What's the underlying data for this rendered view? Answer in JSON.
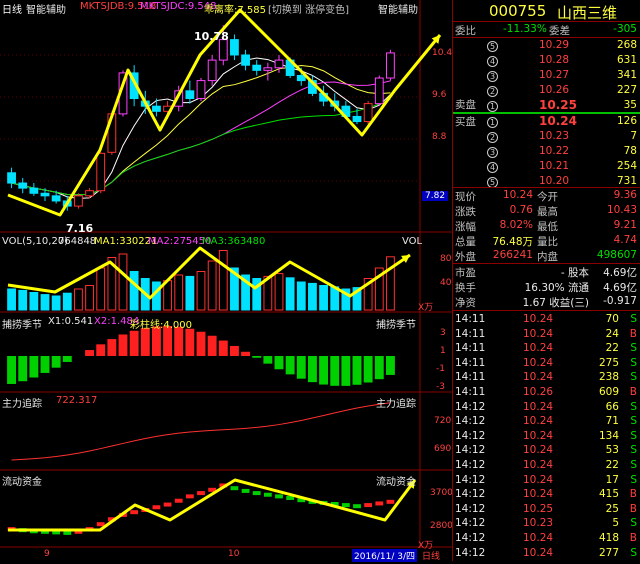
{
  "chart": {
    "panels": [
      {
        "title": "日线",
        "indicator": "智能辅助",
        "readouts": [
          {
            "text": "MKTSJDB:9.518",
            "color": "#ff4040"
          },
          {
            "text": "MKTSJDC:9.548",
            "color": "#ff40ff"
          },
          {
            "text": "乖离率:7.585",
            "color": "#ffff40"
          },
          {
            "text": "[切换到 涨停变色]",
            "color": "#c0c0c0"
          }
        ],
        "right_title": "智能辅助",
        "ticks": [
          "10.4",
          "9.6",
          "8.8"
        ],
        "last_value": "7.82",
        "high_label": "10.78",
        "low_label": "7.16"
      },
      {
        "title": "VOL(5,10,20)",
        "readouts": [
          {
            "text": "764848",
            "color": "#e8e8e8"
          },
          {
            "text": "MA1:330221",
            "color": "#ffff40"
          },
          {
            "text": "MA2:275450",
            "color": "#ff40ff"
          },
          {
            "text": "MA3:363480",
            "color": "#00e000"
          }
        ],
        "right_title": "VOL",
        "ticks": [
          "80",
          "40"
        ],
        "unit": "X万"
      },
      {
        "title": "捕捞季节",
        "readouts": [
          {
            "text": "X1:0.541",
            "color": "#e8e8e8"
          },
          {
            "text": "X2:1.484",
            "color": "#ff40ff"
          },
          {
            "text": "彩柱线:4.000",
            "color": "#ffff40"
          }
        ],
        "right_title": "捕捞季节",
        "ticks": [
          "3",
          "1",
          "-1",
          "-3"
        ]
      },
      {
        "title": "主力追踪",
        "readouts": [
          {
            "text": "722.317",
            "color": "#ff4040"
          }
        ],
        "right_title": "主力追踪",
        "ticks": [
          "720",
          "690"
        ]
      },
      {
        "title": "流动资金",
        "readouts": [],
        "right_title": "流动资金",
        "ticks": [
          "3700",
          "2800"
        ],
        "unit": "X万"
      }
    ],
    "x_labels": [
      "9",
      "10"
    ],
    "date_label": "2016/11/ 3/四",
    "period_tab": "日线"
  },
  "chart_data": {
    "type": "candlestick",
    "series": [
      {
        "name": "K线",
        "ohlc": [
          [
            7.9,
            8.0,
            7.6,
            7.7
          ],
          [
            7.7,
            7.8,
            7.5,
            7.6
          ],
          [
            7.6,
            7.7,
            7.45,
            7.5
          ],
          [
            7.5,
            7.6,
            7.35,
            7.45
          ],
          [
            7.45,
            7.55,
            7.3,
            7.35
          ],
          [
            7.35,
            7.45,
            7.16,
            7.25
          ],
          [
            7.25,
            7.5,
            7.2,
            7.45
          ],
          [
            7.45,
            7.6,
            7.4,
            7.55
          ],
          [
            7.55,
            8.3,
            7.5,
            8.28
          ],
          [
            8.3,
            9.1,
            8.25,
            9.05
          ],
          [
            9.05,
            9.9,
            9.0,
            9.85
          ],
          [
            9.85,
            10.0,
            9.2,
            9.35
          ],
          [
            9.3,
            9.5,
            9.05,
            9.2
          ],
          [
            9.2,
            9.35,
            9.0,
            9.1
          ],
          [
            9.1,
            9.3,
            8.95,
            9.2
          ],
          [
            9.2,
            9.6,
            9.1,
            9.5
          ],
          [
            9.5,
            9.7,
            9.25,
            9.35
          ],
          [
            9.35,
            9.75,
            9.3,
            9.7
          ],
          [
            9.7,
            10.2,
            9.6,
            10.1
          ],
          [
            10.1,
            10.78,
            10.0,
            10.5
          ],
          [
            10.5,
            10.6,
            10.1,
            10.2
          ],
          [
            10.2,
            10.3,
            9.9,
            10.0
          ],
          [
            10.0,
            10.1,
            9.8,
            9.9
          ],
          [
            9.9,
            10.05,
            9.7,
            9.95
          ],
          [
            9.95,
            10.2,
            9.85,
            10.1
          ],
          [
            10.1,
            10.15,
            9.75,
            9.8
          ],
          [
            9.8,
            9.95,
            9.6,
            9.7
          ],
          [
            9.7,
            9.8,
            9.4,
            9.45
          ],
          [
            9.45,
            9.6,
            9.2,
            9.3
          ],
          [
            9.3,
            9.45,
            9.1,
            9.2
          ],
          [
            9.2,
            9.3,
            8.95,
            9.0
          ],
          [
            9.0,
            9.15,
            8.85,
            8.9
          ],
          [
            8.9,
            9.3,
            8.85,
            9.25
          ],
          [
            9.25,
            9.8,
            9.2,
            9.75
          ],
          [
            9.75,
            10.3,
            9.7,
            10.24
          ]
        ]
      }
    ],
    "volume": [
      30,
      28,
      25,
      22,
      20,
      24,
      30,
      35,
      60,
      75,
      80,
      55,
      45,
      40,
      42,
      50,
      48,
      55,
      70,
      85,
      60,
      50,
      45,
      48,
      52,
      46,
      40,
      38,
      35,
      33,
      30,
      32,
      45,
      60,
      76
    ],
    "flow": [
      2900,
      2880,
      2860,
      2850,
      2840,
      2830,
      2850,
      2900,
      2990,
      3080,
      3160,
      3210,
      3250,
      3300,
      3350,
      3420,
      3500,
      3560,
      3620,
      3700,
      3650,
      3600,
      3560,
      3530,
      3500,
      3470,
      3430,
      3400,
      3380,
      3360,
      3340,
      3320,
      3340,
      3370,
      3400
    ],
    "price_range": [
      6.9,
      11.0
    ]
  },
  "quote": {
    "code": "000755",
    "name": "山西三维",
    "weibi_label": "委比",
    "weibi_value": "-11.33%",
    "weicha_label": "委差",
    "weicha_value": "-305",
    "sell_label": "卖盘",
    "buy_label": "买盘",
    "asks": [
      {
        "level": "5",
        "price": "10.29",
        "vol": "268"
      },
      {
        "level": "4",
        "price": "10.28",
        "vol": "631"
      },
      {
        "level": "3",
        "price": "10.27",
        "vol": "341"
      },
      {
        "level": "2",
        "price": "10.26",
        "vol": "227"
      },
      {
        "level": "1",
        "price": "10.25",
        "vol": "35"
      }
    ],
    "bids": [
      {
        "level": "1",
        "price": "10.24",
        "vol": "126"
      },
      {
        "level": "2",
        "price": "10.23",
        "vol": "7"
      },
      {
        "level": "3",
        "price": "10.22",
        "vol": "78"
      },
      {
        "level": "4",
        "price": "10.21",
        "vol": "254"
      },
      {
        "level": "5",
        "price": "10.20",
        "vol": "731"
      }
    ],
    "stats": [
      {
        "l1": "现价",
        "v1": "10.24",
        "c1": "#ff4040",
        "l2": "今开",
        "v2": "9.36",
        "c2": "#ff4040"
      },
      {
        "l1": "涨跌",
        "v1": "0.76",
        "c1": "#ff4040",
        "l2": "最高",
        "v2": "10.43",
        "c2": "#ff4040"
      },
      {
        "l1": "涨幅",
        "v1": "8.02%",
        "c1": "#ff4040",
        "l2": "最低",
        "v2": "9.21",
        "c2": "#ff4040"
      },
      {
        "l1": "总量",
        "v1": "76.48万",
        "c1": "#ffff40",
        "l2": "量比",
        "v2": "4.74",
        "c2": "#ff4040"
      },
      {
        "l1": "外盘",
        "v1": "266241",
        "c1": "#ff4040",
        "l2": "内盘",
        "v2": "498607",
        "c2": "#00e000"
      }
    ],
    "stats2": [
      {
        "l1": "市盈",
        "v1": "- 股本",
        "l2": "",
        "v2": "4.69亿"
      },
      {
        "l1": "换手",
        "v1": "16.30% 流通",
        "l2": "",
        "v2": "4.69亿"
      },
      {
        "l1": "净资",
        "v1": "1.67 收益(三)",
        "l2": "",
        "v2": "-0.917"
      }
    ],
    "ticks": [
      {
        "t": "14:11",
        "p": "10.24",
        "v": "70",
        "s": "S"
      },
      {
        "t": "14:11",
        "p": "10.24",
        "v": "24",
        "s": "B"
      },
      {
        "t": "14:11",
        "p": "10.24",
        "v": "22",
        "s": "S"
      },
      {
        "t": "14:11",
        "p": "10.24",
        "v": "275",
        "s": "S"
      },
      {
        "t": "14:11",
        "p": "10.24",
        "v": "238",
        "s": "S"
      },
      {
        "t": "14:11",
        "p": "10.26",
        "v": "609",
        "s": "B"
      },
      {
        "t": "14:12",
        "p": "10.24",
        "v": "66",
        "s": "S"
      },
      {
        "t": "14:12",
        "p": "10.24",
        "v": "71",
        "s": "S"
      },
      {
        "t": "14:12",
        "p": "10.24",
        "v": "134",
        "s": "S"
      },
      {
        "t": "14:12",
        "p": "10.24",
        "v": "53",
        "s": "S"
      },
      {
        "t": "14:12",
        "p": "10.24",
        "v": "22",
        "s": "S"
      },
      {
        "t": "14:12",
        "p": "10.24",
        "v": "17",
        "s": "S"
      },
      {
        "t": "14:12",
        "p": "10.24",
        "v": "415",
        "s": "B"
      },
      {
        "t": "14:12",
        "p": "10.25",
        "v": "25",
        "s": "B"
      },
      {
        "t": "14:12",
        "p": "10.23",
        "v": "5",
        "s": "S"
      },
      {
        "t": "14:12",
        "p": "10.24",
        "v": "418",
        "s": "B"
      },
      {
        "t": "14:12",
        "p": "10.24",
        "v": "277",
        "s": "S"
      }
    ]
  }
}
